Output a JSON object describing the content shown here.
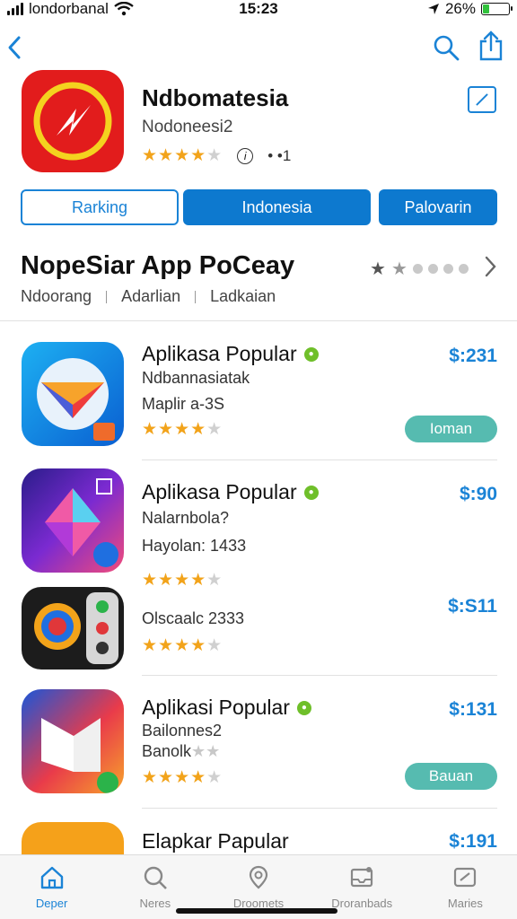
{
  "status_bar": {
    "carrier": "londorbanal",
    "time": "15:23",
    "battery": "26%",
    "battery_level": 0.26
  },
  "header": {
    "title": "Ndbomatesia",
    "subtitle": "Nodoneesi2",
    "rating": 4.5,
    "rating_count": "• •1"
  },
  "segments": [
    "Rarking",
    "Indonesia",
    "Palovarin"
  ],
  "section": {
    "title": "NopeSiar App PoCeay",
    "tabs": [
      "Ndoorang",
      "Adarlian",
      "Ladkaian"
    ]
  },
  "apps": [
    {
      "name": "Aplikasa Popular",
      "line1": "Ndbannasiatak",
      "line2": "Maplir a-3S",
      "price": "$:231",
      "button": "Ioman"
    },
    {
      "name": "Aplikasa Popular",
      "line1": "Nalarnbola?",
      "line2": "Hayolan: 1433",
      "price": "$:90",
      "button": ""
    },
    {
      "name": "",
      "line1": "Olscaalc 2333",
      "line2": "",
      "price": "$:S11",
      "button": ""
    },
    {
      "name": "Aplikasi Popular",
      "line1": "Bailonnes2",
      "line2": "Banolk",
      "price": "$:131",
      "button": "Bauan"
    },
    {
      "name": "Elapkar Papular",
      "line1": "",
      "line2": "",
      "price": "$:191",
      "button": ""
    }
  ],
  "tab_bar": [
    {
      "label": "Deper",
      "icon": "home-icon"
    },
    {
      "label": "Neres",
      "icon": "search-icon"
    },
    {
      "label": "Droomets",
      "icon": "location-icon"
    },
    {
      "label": "Droranbads",
      "icon": "inbox-icon"
    },
    {
      "label": "Maries",
      "icon": "media-icon"
    }
  ],
  "colors": {
    "accent": "#1a83d6",
    "star": "#f2a31a",
    "get_button": "#56bbb0",
    "header_icon": "#e21c1c"
  }
}
